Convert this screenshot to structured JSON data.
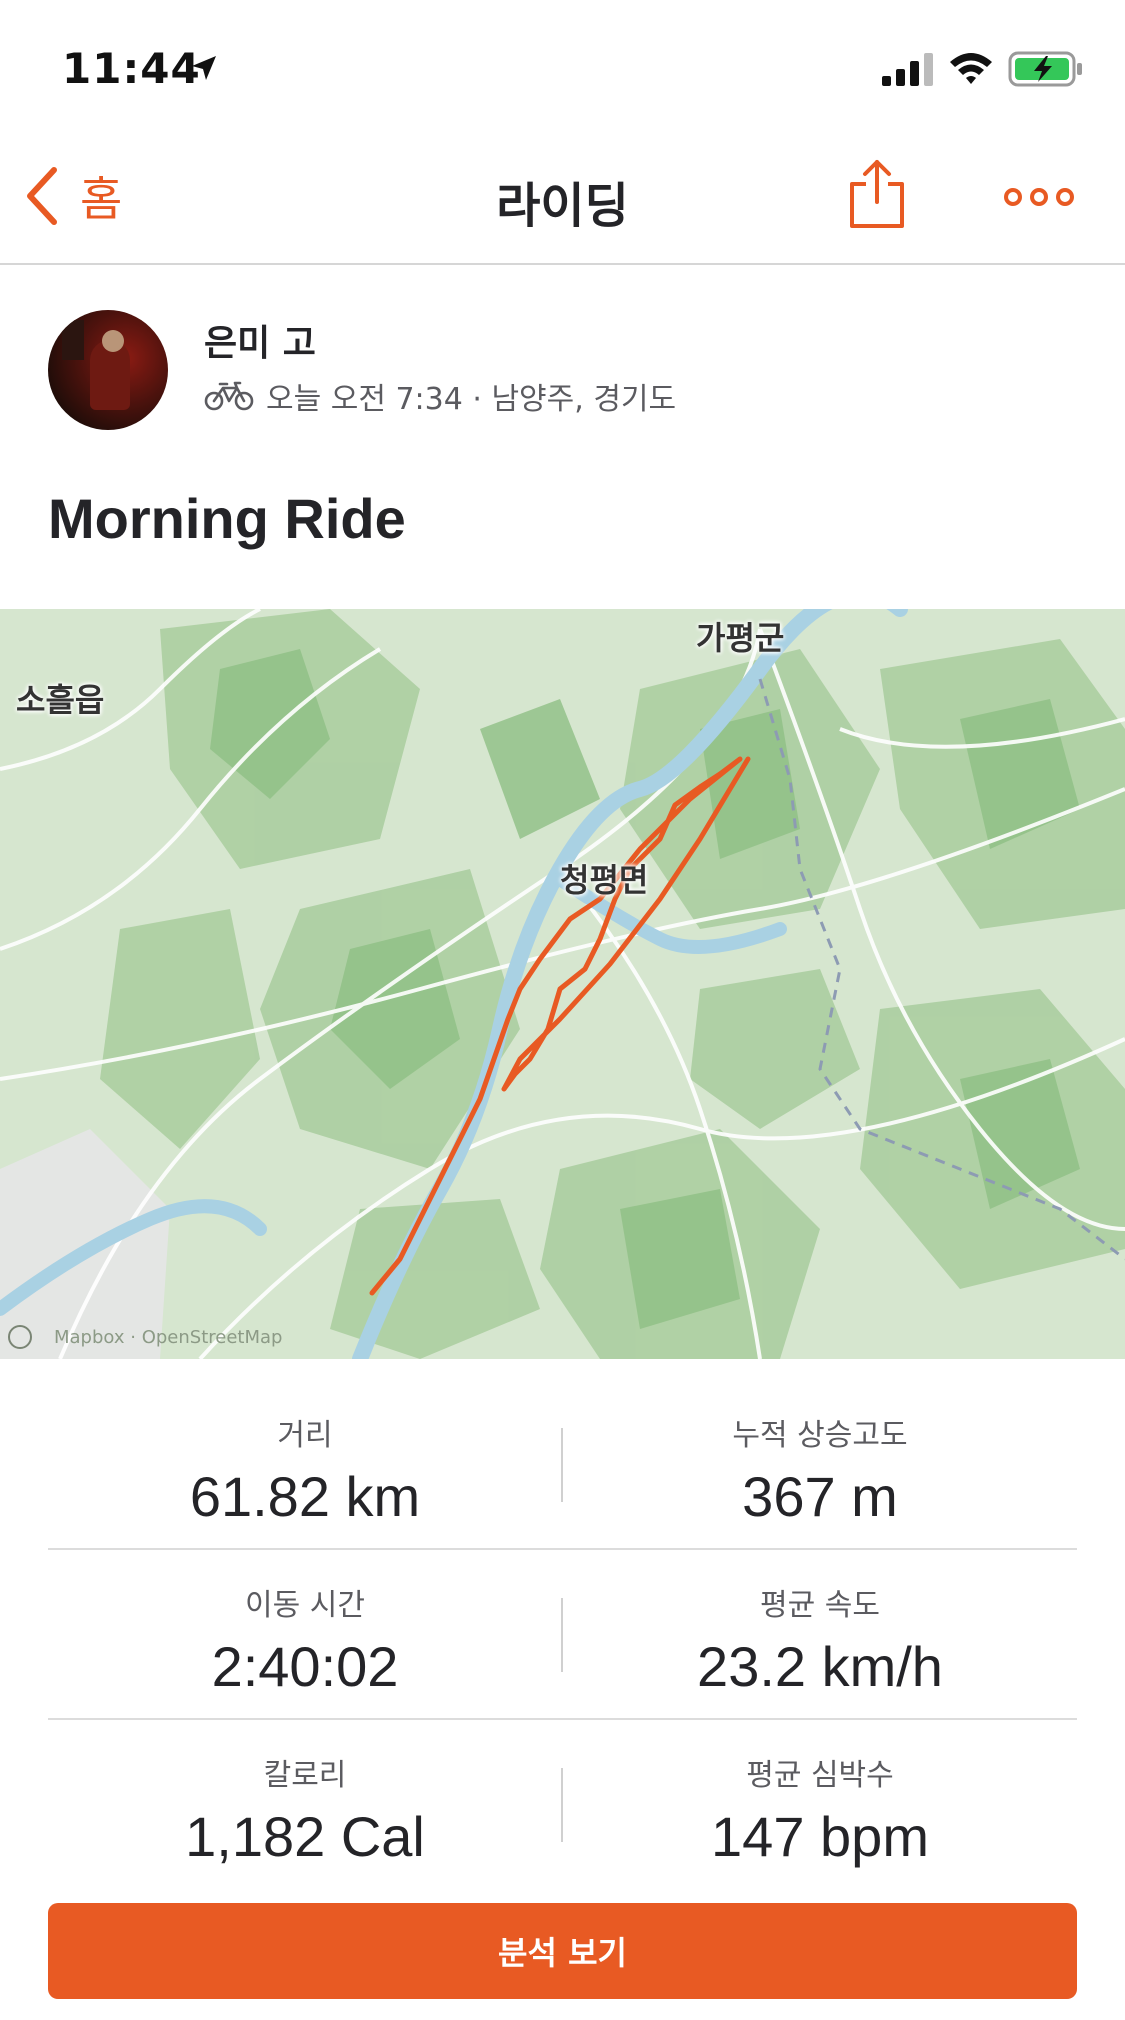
{
  "status_bar": {
    "time": "11:44"
  },
  "nav": {
    "back_label": "홈",
    "title": "라이딩"
  },
  "athlete": {
    "name": "은미 고",
    "meta": "오늘 오전 7:34 · 남양주, 경기도"
  },
  "activity": {
    "title": "Morning Ride"
  },
  "map": {
    "labels": {
      "gapyeong": "가평군",
      "soheul": "소흘읍",
      "cheongpyeong": "청평면"
    },
    "attribution": "Mapbox · OpenStreetMap",
    "route_color": "#e85a23"
  },
  "stats": [
    {
      "label": "거리",
      "value": "61.82 km"
    },
    {
      "label": "누적 상승고도",
      "value": "367 m"
    },
    {
      "label": "이동 시간",
      "value": "2:40:02"
    },
    {
      "label": "평균 속도",
      "value": "23.2 km/h"
    },
    {
      "label": "칼로리",
      "value": "1,182 Cal"
    },
    {
      "label": "평균 심박수",
      "value": "147 bpm"
    }
  ],
  "actions": {
    "analysis_label": "분석 보기"
  },
  "colors": {
    "accent": "#e85a23",
    "text": "#242428",
    "muted": "#5b5b60"
  }
}
